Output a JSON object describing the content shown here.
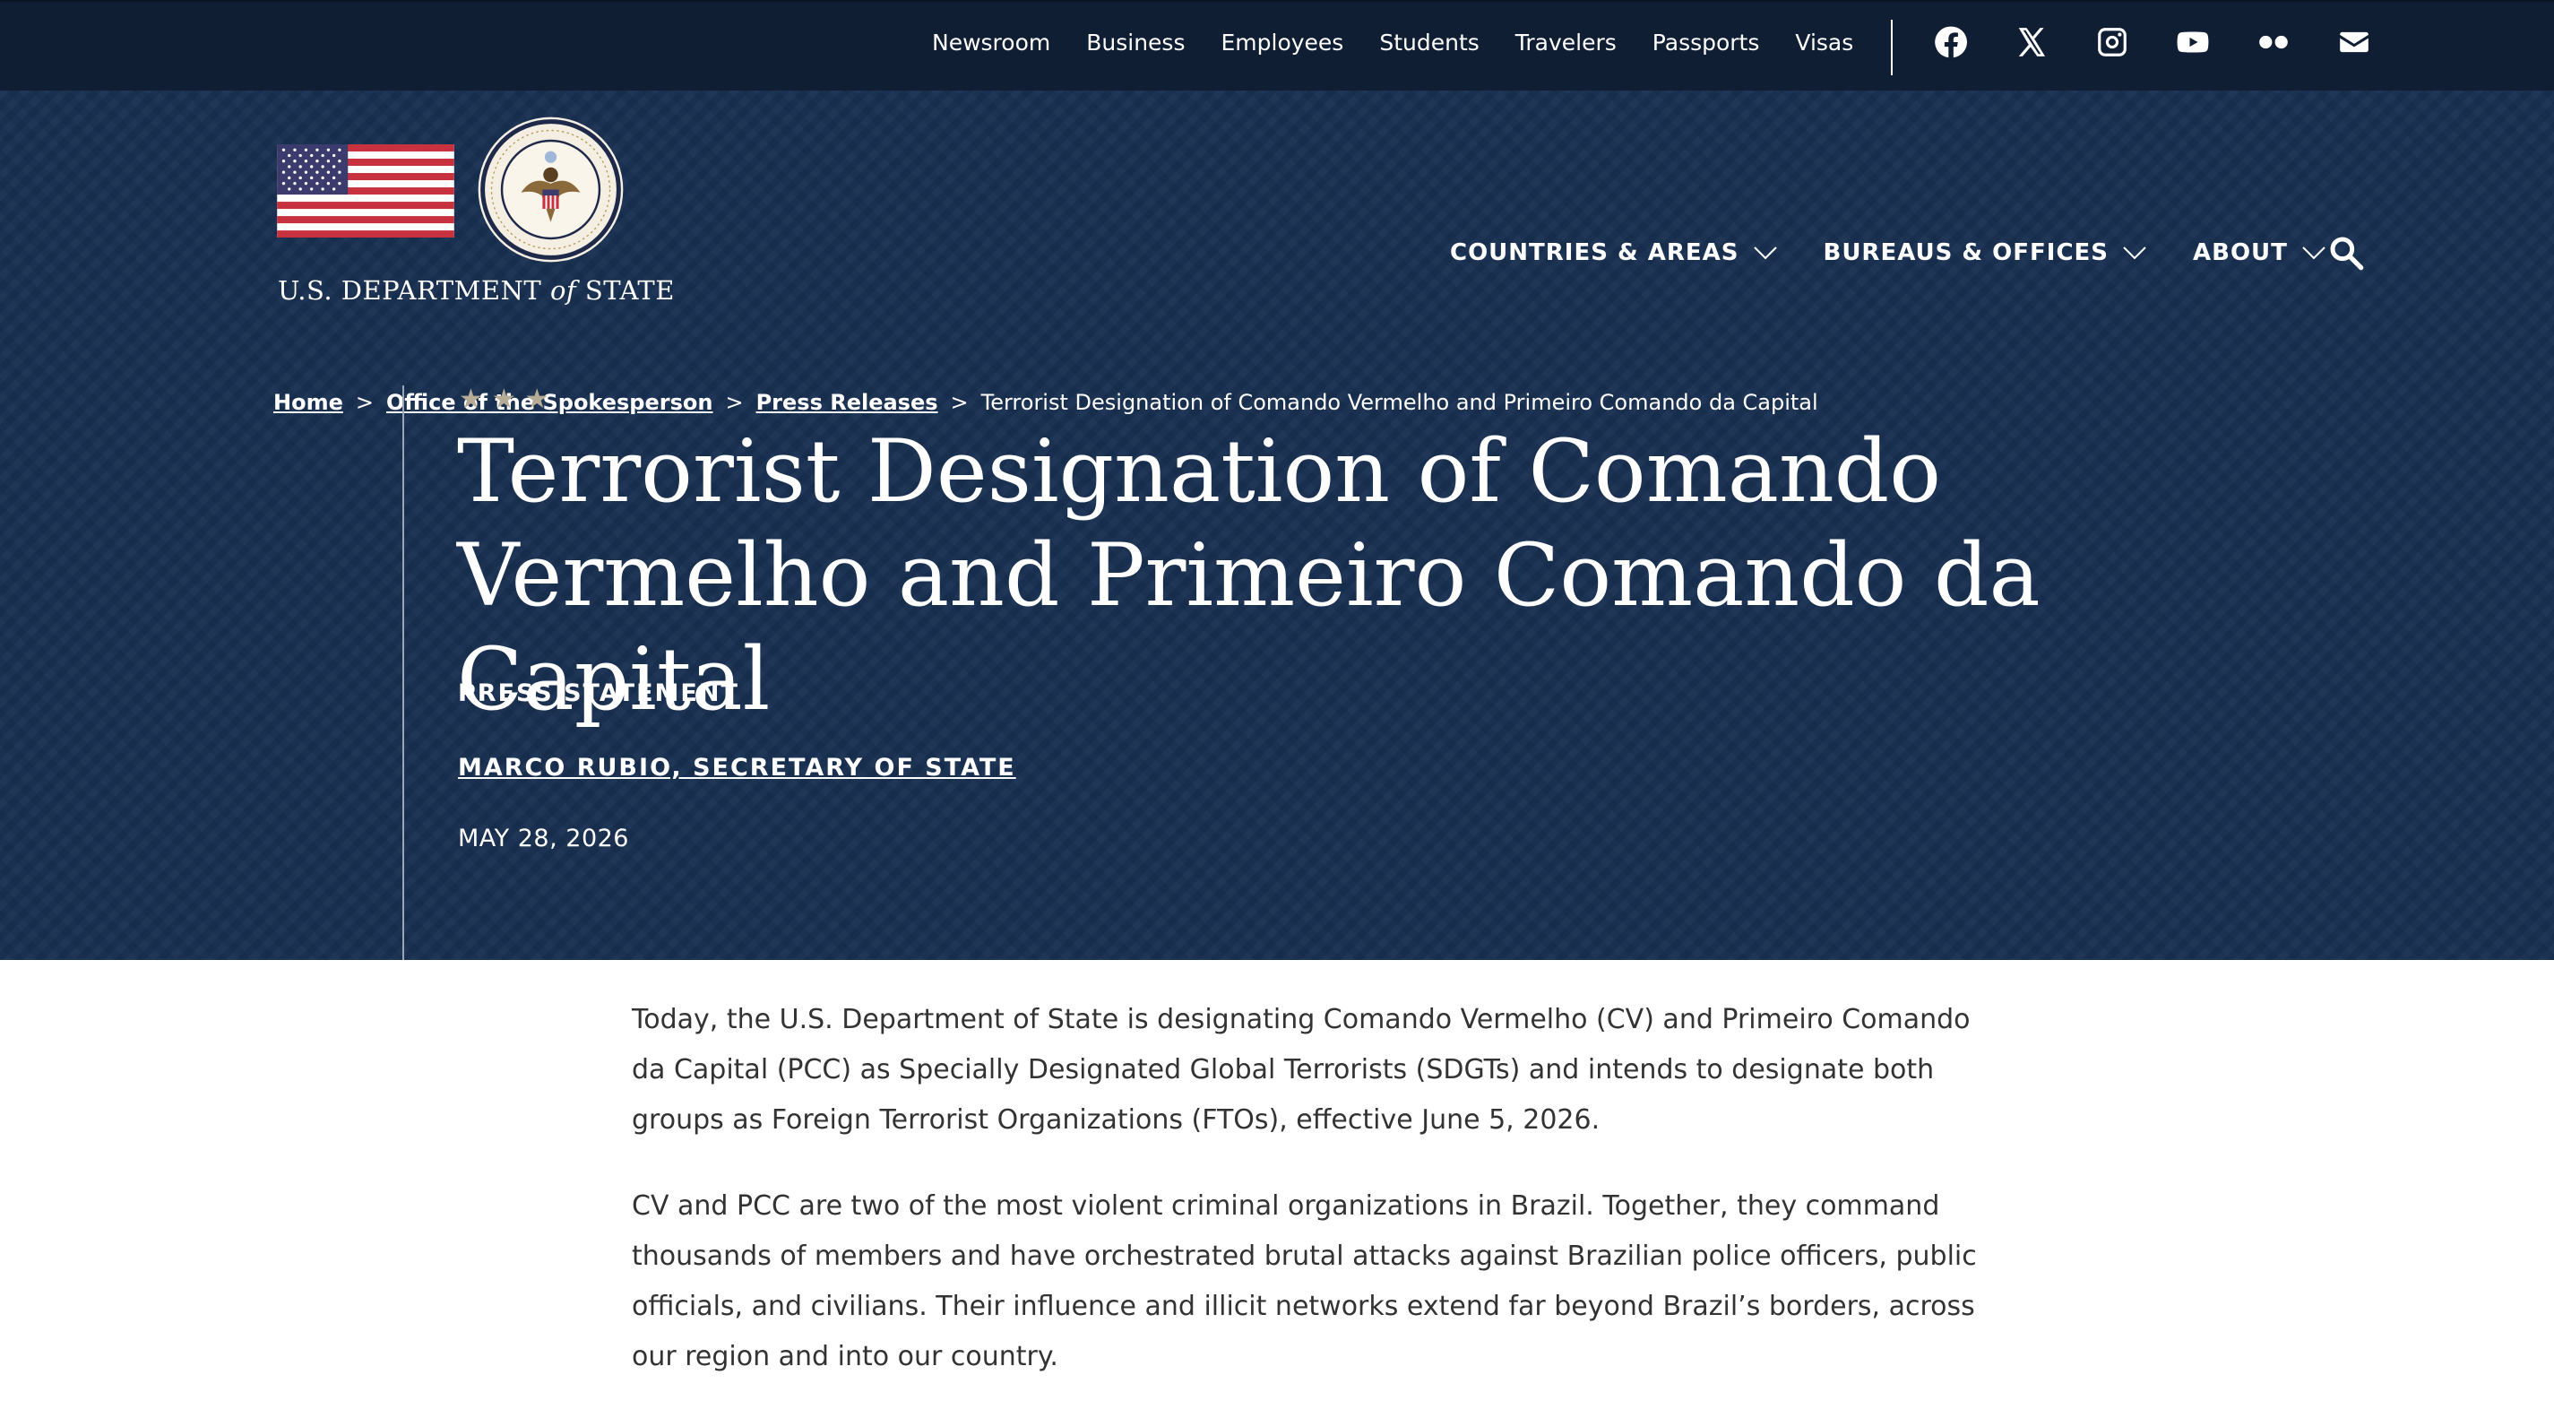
{
  "utility_nav": {
    "links": [
      "Newsroom",
      "Business",
      "Employees",
      "Students",
      "Travelers",
      "Passports",
      "Visas"
    ],
    "social": [
      "facebook-icon",
      "x-icon",
      "instagram-icon",
      "youtube-icon",
      "flickr-icon",
      "email-icon"
    ]
  },
  "logo": {
    "text_before": "U.S. DEPARTMENT ",
    "text_italic": "of",
    "text_after": " STATE"
  },
  "main_nav": {
    "items": [
      "COUNTRIES & AREAS",
      "BUREAUS & OFFICES",
      "ABOUT"
    ]
  },
  "breadcrumb": {
    "items": [
      "Home",
      "Office of the Spokesperson",
      "Press Releases"
    ],
    "current": "Terrorist Designation of Comando Vermelho and Primeiro Comando da Capital",
    "separator": ">"
  },
  "article": {
    "stars": "★★★",
    "title": "Terrorist Designation of Comando Vermelho and Primeiro Comando da Capital",
    "type": "PRESS STATEMENT",
    "author": "MARCO RUBIO, SECRETARY OF STATE",
    "date": "MAY 28, 2026",
    "paragraphs": [
      "Today, the U.S. Department of State is designating Comando Vermelho (CV) and Primeiro Comando da Capital (PCC) as Specially Designated Global Terrorists (SDGTs) and intends to designate both groups as Foreign Terrorist Organizations (FTOs), effective June 5, 2026.",
      "CV and PCC are two of the most violent criminal organizations in Brazil. Together, they command thousands of members and have orchestrated brutal attacks against Brazilian police officers, public officials, and civilians. Their influence and illicit networks extend far beyond Brazil’s borders, across our region and into our country."
    ]
  },
  "colors": {
    "utility_bg": "#0f1e33",
    "hero_bg": "#182f50",
    "star_gold": "#b6ab94"
  }
}
